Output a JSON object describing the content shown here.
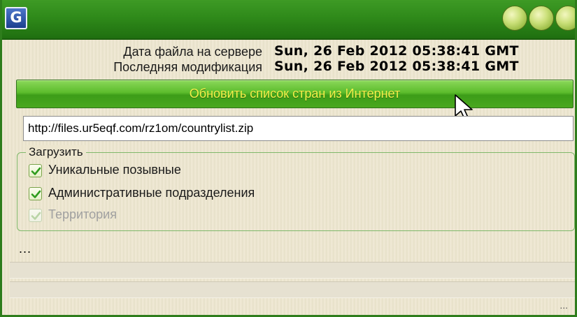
{
  "window": {
    "app_icon_glyph": "G",
    "accent_color": "#2f8a1a"
  },
  "info": {
    "server_date_label": "Дата файла на сервере",
    "server_date_value": "Sun, 26 Feb 2012 05:38:41 GMT",
    "modified_label": "Последняя модификация",
    "modified_value": "Sun, 26 Feb 2012 05:38:41 GMT"
  },
  "update_button": {
    "label": "Обновить список стран из Интернет"
  },
  "url_field": {
    "value": "http://files.ur5eqf.com/rz1om/countrylist.zip"
  },
  "download_group": {
    "title": "Загрузить",
    "options": [
      {
        "label": "Уникальные позывные",
        "checked": true,
        "enabled": true
      },
      {
        "label": "Административные подразделения",
        "checked": true,
        "enabled": true
      },
      {
        "label": "Территория",
        "checked": true,
        "enabled": false
      }
    ]
  },
  "status": {
    "text": "...",
    "corner_text": "..."
  }
}
